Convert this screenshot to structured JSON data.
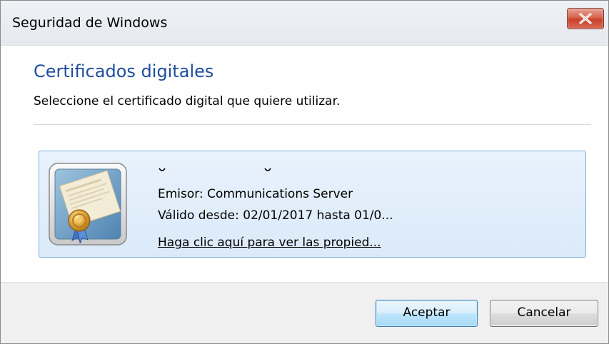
{
  "window": {
    "title": "Seguridad de Windows"
  },
  "dialog": {
    "heading": "Certificados digitales",
    "subheading": "Seleccione el certificado digital que quiere utilizar."
  },
  "certificate": {
    "icon": "certificate-icon",
    "issuer": "Emisor: Communications Server",
    "validity": "Válido desde: 02/01/2017 hasta 01/0...",
    "properties_link": "Haga clic aquí para ver las propied..."
  },
  "buttons": {
    "accept": "Aceptar",
    "cancel": "Cancelar"
  },
  "colors": {
    "heading": "#1e4e9e",
    "card_background": "#dbeaf9",
    "card_border": "#7fb0db",
    "close_button": "#c9412a"
  }
}
